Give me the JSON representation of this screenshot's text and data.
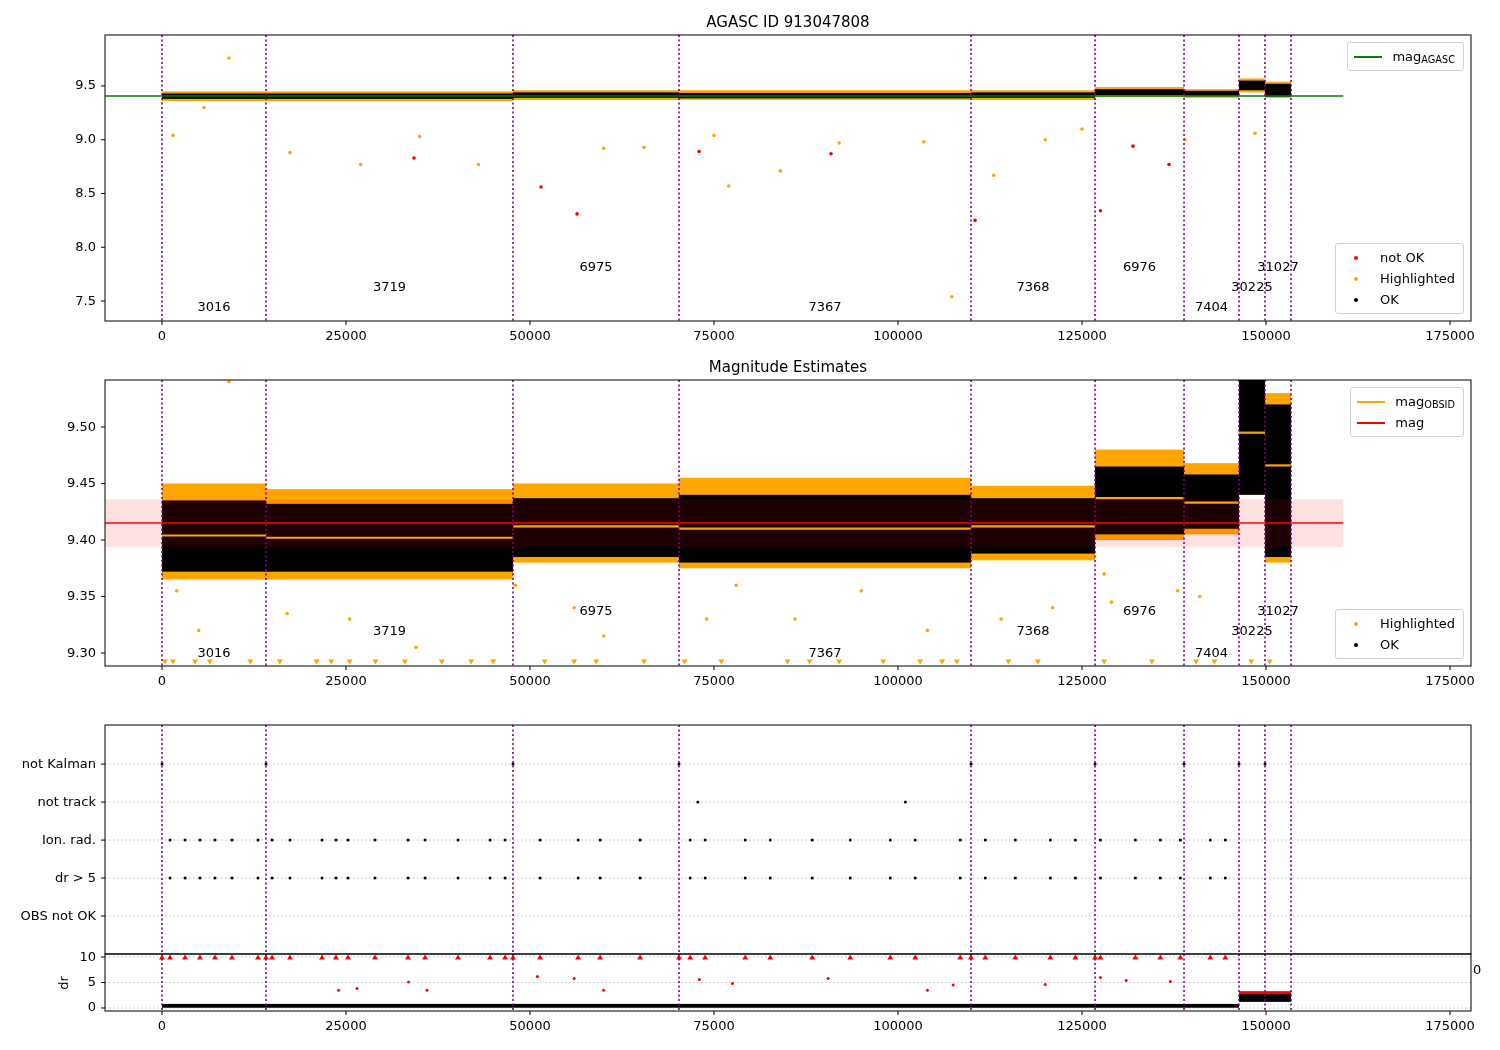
{
  "figure": {
    "panels": [
      {
        "title": "AGASC ID 913047808",
        "x_tick_labels": [
          "0",
          "25000",
          "50000",
          "75000",
          "100000",
          "125000",
          "150000",
          "175000"
        ],
        "y_tick_labels": [
          "9.5",
          "9.0",
          "8.5",
          "8.0",
          "7.5"
        ],
        "obsid_labels": [
          "3016",
          "3719",
          "6975",
          "7367",
          "7368",
          "6976",
          "7404",
          "30225",
          "31027"
        ],
        "legends": [
          {
            "entries": [
              {
                "label": "mag$_{AGASC}$",
                "kind": "line",
                "color": "#008000"
              }
            ]
          },
          {
            "entries": [
              {
                "label": "not OK",
                "kind": "dot",
                "color": "#ff0000"
              },
              {
                "label": "Highlighted",
                "kind": "dot",
                "color": "#ffa500"
              },
              {
                "label": "OK",
                "kind": "dot",
                "color": "#000000"
              }
            ]
          }
        ]
      },
      {
        "title": "Magnitude Estimates",
        "x_tick_labels": [
          "0",
          "25000",
          "50000",
          "75000",
          "100000",
          "125000",
          "150000",
          "175000"
        ],
        "y_tick_labels": [
          "9.50",
          "9.45",
          "9.40",
          "9.35",
          "9.30"
        ],
        "obsid_labels": [
          "3016",
          "3719",
          "6975",
          "7367",
          "7368",
          "6976",
          "7404",
          "30225",
          "31027"
        ],
        "legends": [
          {
            "entries": [
              {
                "label": "mag$_{OBSID}$",
                "kind": "line",
                "color": "#ffa500"
              },
              {
                "label": "mag",
                "kind": "line",
                "color": "#ff0000"
              }
            ]
          },
          {
            "entries": [
              {
                "label": "Highlighted",
                "kind": "dot",
                "color": "#ffa500"
              },
              {
                "label": "OK",
                "kind": "dot",
                "color": "#000000"
              }
            ]
          }
        ]
      },
      {
        "y_tick_labels": [
          "not Kalman",
          "not track",
          "Ion. rad.",
          "dr > 5",
          "OBS not OK"
        ]
      },
      {
        "ylabel": "dr",
        "edge_label": "0",
        "x_tick_labels": [
          "0",
          "25000",
          "50000",
          "75000",
          "100000",
          "125000",
          "150000",
          "175000"
        ],
        "y_tick_labels": [
          "10",
          "5",
          "0"
        ]
      }
    ]
  }
}
